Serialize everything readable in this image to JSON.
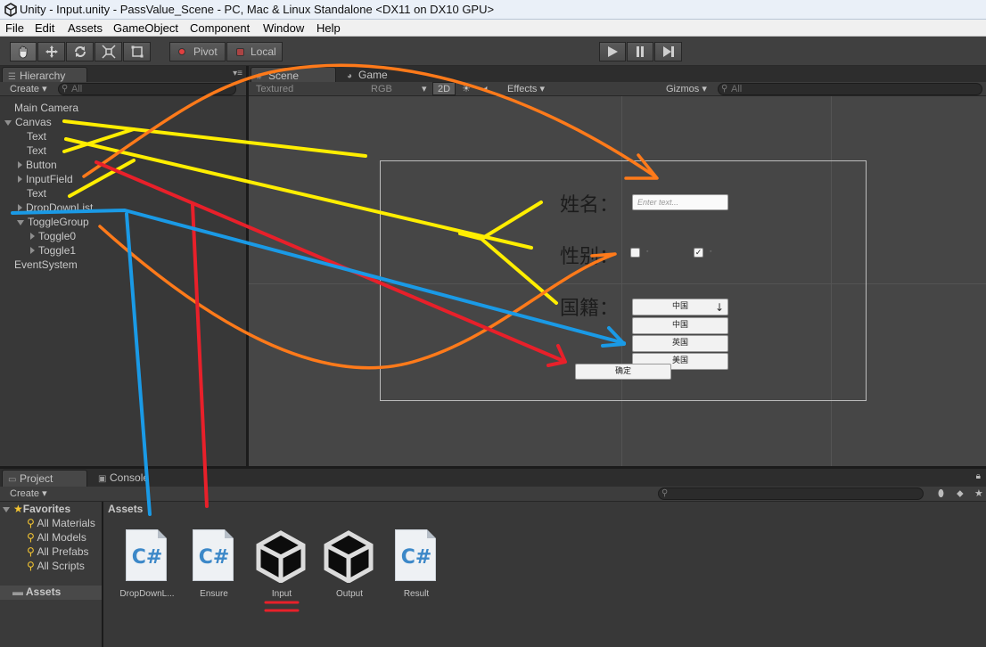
{
  "window": {
    "title": "Unity - Input.unity - PassValue_Scene - PC, Mac & Linux Standalone <DX11 on DX10 GPU>"
  },
  "menu": [
    "File",
    "Edit",
    "Assets",
    "GameObject",
    "Component",
    "Window",
    "Help"
  ],
  "toolbar": {
    "pivot_label": "Pivot",
    "local_label": "Local"
  },
  "hierarchy": {
    "tab_label": "Hierarchy",
    "create_label": "Create",
    "search_placeholder": "All",
    "items": [
      {
        "label": "Main Camera"
      },
      {
        "label": "Canvas"
      },
      {
        "label": "Text"
      },
      {
        "label": "Text"
      },
      {
        "label": "Button"
      },
      {
        "label": "InputField"
      },
      {
        "label": "Text"
      },
      {
        "label": "DropDownList"
      },
      {
        "label": "ToggleGroup"
      },
      {
        "label": "Toggle0"
      },
      {
        "label": "Toggle1"
      },
      {
        "label": "EventSystem"
      }
    ]
  },
  "scene": {
    "tab_scene": "Scene",
    "tab_game": "Game",
    "shading_mode": "Textured",
    "render_mode": "RGB",
    "mode_2d": "2D",
    "effects_label": "Effects",
    "gizmos_label": "Gizmos",
    "search_placeholder": "All",
    "form": {
      "name_label": "姓名：",
      "name_placeholder": "Enter text...",
      "gender_label": "性别：",
      "nationality_label": "国籍：",
      "dropdown_value": "中国",
      "dropdown_options": [
        "中国",
        "英国",
        "美国"
      ],
      "confirm_label": "确定"
    }
  },
  "project": {
    "tab_project": "Project",
    "tab_console": "Console",
    "create_label": "Create",
    "favorites_label": "Favorites",
    "favorites": [
      "All Materials",
      "All Models",
      "All Prefabs",
      "All Scripts"
    ],
    "assets_label": "Assets",
    "assets_header": "Assets",
    "files": [
      {
        "name": "DropDownL...",
        "kind": "csharp"
      },
      {
        "name": "Ensure",
        "kind": "csharp"
      },
      {
        "name": "Input",
        "kind": "unity"
      },
      {
        "name": "Output",
        "kind": "unity"
      },
      {
        "name": "Result",
        "kind": "csharp"
      }
    ]
  },
  "colors": {
    "annotation_yellow": "#ffee00",
    "annotation_orange": "#ff7a1a",
    "annotation_red": "#e8202a",
    "annotation_blue": "#1a9ae6"
  }
}
